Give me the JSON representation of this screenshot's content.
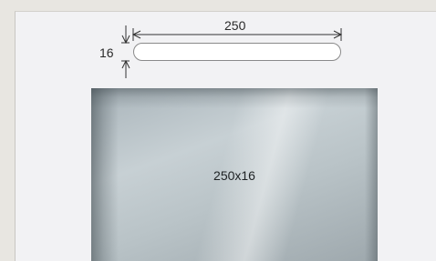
{
  "dimensions": {
    "width_value": "250",
    "height_value": "16"
  },
  "preview": {
    "size_label": "250x16"
  },
  "colors": {
    "background": "#e8e6e1",
    "panel": "#f2f2f4",
    "field_border": "#8a8a8a",
    "preview_glass": "#c7d0d4"
  }
}
